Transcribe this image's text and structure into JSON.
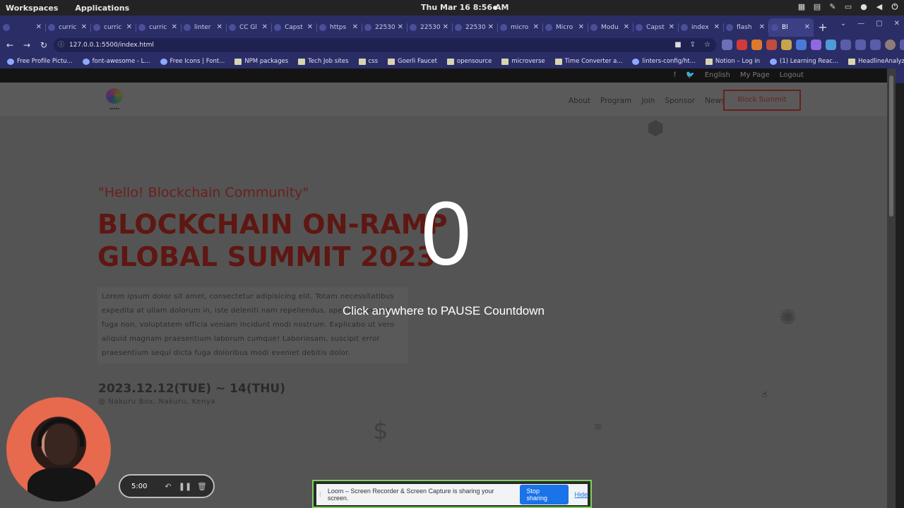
{
  "os": {
    "workspaces": "Workspaces",
    "applications": "Applications",
    "clock": "Thu Mar 16  8:56 AM"
  },
  "tabs": [
    {
      "label": "",
      "icon": "loom-icon",
      "active": false
    },
    {
      "label": "curric",
      "icon": "github-icon",
      "active": false
    },
    {
      "label": "curric",
      "icon": "github-icon",
      "active": false
    },
    {
      "label": "curric",
      "icon": "github-icon",
      "active": false
    },
    {
      "label": "linter",
      "icon": "github-icon",
      "active": false
    },
    {
      "label": "CC Gl",
      "icon": "behance-icon",
      "active": false
    },
    {
      "label": "Capst",
      "icon": "github-icon",
      "active": false
    },
    {
      "label": "https",
      "icon": "globe-icon",
      "active": false
    },
    {
      "label": "22530",
      "icon": "globe-icon",
      "active": false
    },
    {
      "label": "22530",
      "icon": "globe-icon",
      "active": false
    },
    {
      "label": "22530",
      "icon": "globe-icon",
      "active": false
    },
    {
      "label": "micro",
      "icon": "github-icon",
      "active": false
    },
    {
      "label": "Micro",
      "icon": "figma-icon",
      "active": false
    },
    {
      "label": "Modu",
      "icon": "drive-icon",
      "active": false
    },
    {
      "label": "Capst",
      "icon": "docs-icon",
      "active": false
    },
    {
      "label": "index",
      "icon": "file-icon",
      "active": false
    },
    {
      "label": "flash",
      "icon": "bookmark-icon",
      "active": false
    },
    {
      "label": "Bl",
      "icon": "globe-icon",
      "active": true
    }
  ],
  "address": {
    "url": "127.0.0.1:5500/index.html"
  },
  "bookmarks": [
    "Free Profile Pictu...",
    "font-awesome - L...",
    "Free Icons | Font...",
    "NPM packages",
    "Tech Job sites",
    "css",
    "Goerli Faucet",
    "opensource",
    "microverse",
    "Time Converter a...",
    "linters-config/ht...",
    "Notion – Log in",
    "(1) Learning Reac...",
    "HeadlineAnalyzer..."
  ],
  "site": {
    "util": {
      "english": "English",
      "mypage": "My Page",
      "logout": "Logout"
    },
    "nav": [
      "About",
      "Program",
      "Join",
      "Sponsor",
      "News"
    ],
    "summit_button": "Block Summit",
    "greeting": "\"Hello! Blockchain Community\"",
    "headline_1": "BLOCKCHAIN ON-RAMP",
    "headline_2": "GLOBAL SUMMIT 2023",
    "lorem": "Lorem ipsum dolor sit amet, consectetur adipisicing elit. Totam necessitatibus expedita at ullam dolorum in, iste deleniti nam repellendus, aperiam eveniet fuga non, voluptatem officia veniam incidunt modi nostrum. Explicabo ut vero aliquid magnam praesentium laborum cumque! Laboriosam, suscipit error praesentium sequi dicta fuga doloribus modi eveniet debitis dolor.",
    "date": "2023.12.12(TUE) ~ 14(THU)",
    "place": "@ Nakuru Box, Nakuru, Kenya"
  },
  "loom": {
    "countdown": "0",
    "hint": "Click anywhere to PAUSE Countdown",
    "timer": "5:00",
    "share_message": "Loom – Screen Recorder & Screen Capture is sharing your screen.",
    "stop_sharing": "Stop sharing",
    "hide": "Hide"
  }
}
